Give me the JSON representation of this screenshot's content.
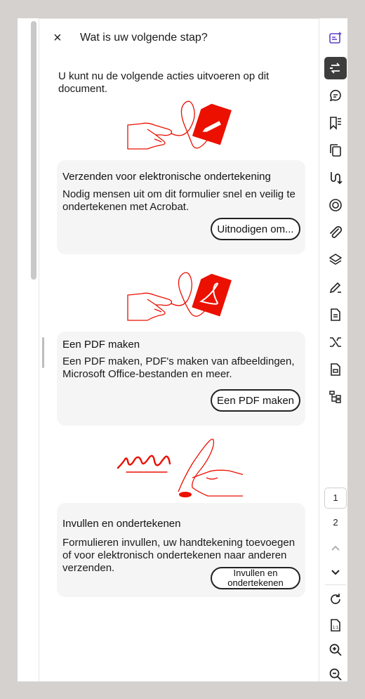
{
  "panel": {
    "close_label": "×",
    "title": "Wat is uw volgende stap?",
    "intro": "U kunt nu de volgende acties uitvoeren op dit document."
  },
  "cards": [
    {
      "title": "Verzenden voor elektronische ondertekening",
      "description": "Nodig mensen uit om dit formulier snel en veilig te ondertekenen met Acrobat.",
      "button": "Uitnodigen om..."
    },
    {
      "title": "Een PDF maken",
      "description": "Een PDF maken, PDF's maken van afbeeldingen, Microsoft Office-bestanden en meer.",
      "button": "Een PDF maken"
    },
    {
      "title": "Invullen en ondertekenen",
      "description": "Formulieren invullen, uw handtekening toevoegen of voor elektronisch ondertekenen naar anderen verzenden.",
      "button": "Invullen en ondertekenen"
    }
  ],
  "rail": {
    "tools": [
      "ai-assistant-icon",
      "convert-icon",
      "comment-icon",
      "bookmark-icon",
      "copy-pages-icon",
      "combine-icon",
      "stamp-icon",
      "attachment-icon",
      "layers-icon",
      "edit-pen-icon",
      "document-icon",
      "export-icon",
      "protect-icon",
      "structure-icon"
    ],
    "current_page": "1",
    "total_pages": "2"
  },
  "colors": {
    "accent": "#eb1000",
    "active_rail": "#3d3d3d",
    "card_bg": "#f5f5f5",
    "ai_icon": "#5b3fc8"
  }
}
